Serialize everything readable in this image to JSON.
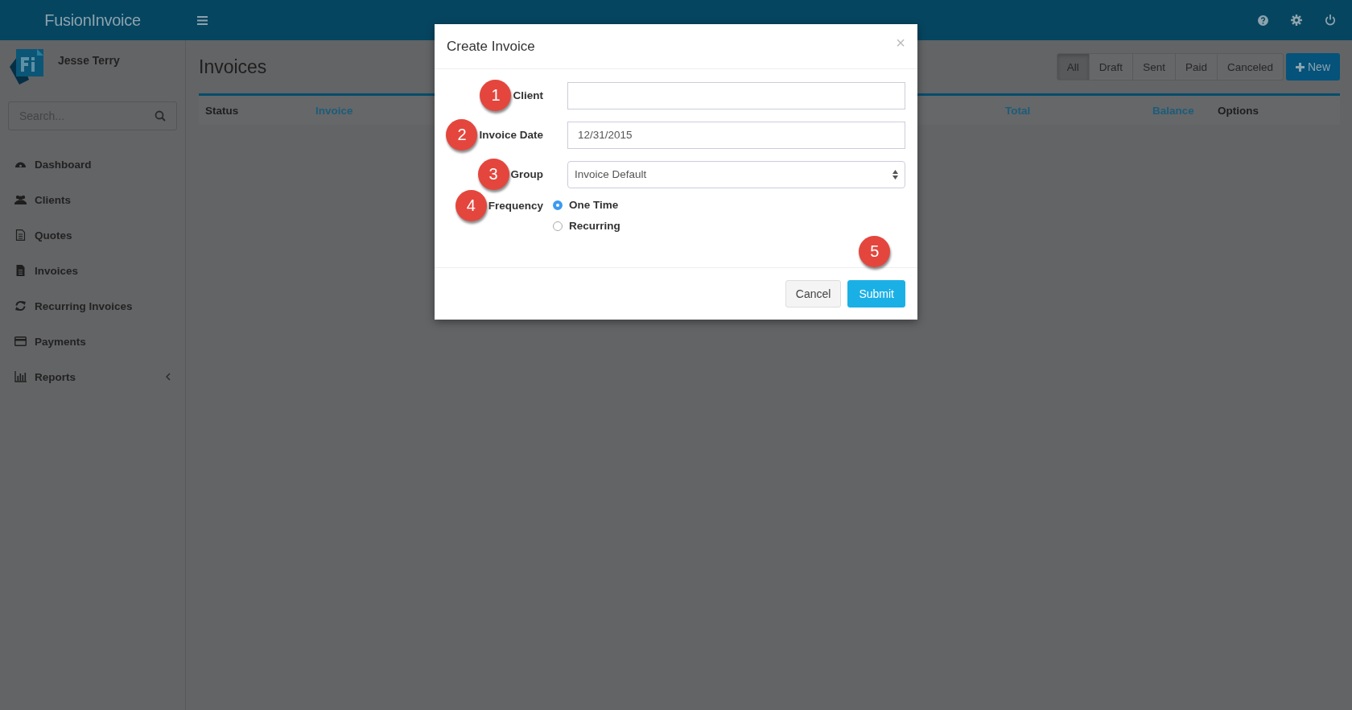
{
  "app": {
    "brand": "FusionInvoice"
  },
  "user": {
    "name": "Jesse Terry"
  },
  "search": {
    "placeholder": "Search..."
  },
  "nav": [
    {
      "label": "Dashboard"
    },
    {
      "label": "Clients"
    },
    {
      "label": "Quotes"
    },
    {
      "label": "Invoices"
    },
    {
      "label": "Recurring Invoices"
    },
    {
      "label": "Payments"
    },
    {
      "label": "Reports",
      "expandable": true
    }
  ],
  "page": {
    "title": "Invoices",
    "filters": [
      {
        "label": "All",
        "selected": true
      },
      {
        "label": "Draft",
        "selected": false
      },
      {
        "label": "Sent",
        "selected": false
      },
      {
        "label": "Paid",
        "selected": false
      },
      {
        "label": "Canceled",
        "selected": false
      }
    ],
    "new_button": "New"
  },
  "table": {
    "columns": [
      {
        "label": "Status",
        "sortable": false
      },
      {
        "label": "Invoice",
        "sortable": true
      },
      {
        "label": "Total",
        "sortable": true
      },
      {
        "label": "Balance",
        "sortable": true
      },
      {
        "label": "Options",
        "sortable": false
      }
    ]
  },
  "modal": {
    "title": "Create Invoice",
    "close": "×",
    "fields": [
      {
        "kind": "text",
        "label": "Client",
        "callout": "1"
      },
      {
        "kind": "text",
        "label": "Invoice Date",
        "callout": "2",
        "value": "12/31/2015"
      },
      {
        "kind": "select",
        "label": "Group",
        "callout": "3",
        "value": "Invoice Default"
      },
      {
        "kind": "radio",
        "label": "Frequency",
        "callout": "4",
        "options": [
          {
            "label": "One Time",
            "selected": true
          },
          {
            "label": "Recurring",
            "selected": false
          }
        ]
      }
    ],
    "buttons": [
      {
        "label": "Cancel",
        "kind": "default"
      },
      {
        "label": "Submit",
        "kind": "primary",
        "callout": "5"
      }
    ]
  }
}
